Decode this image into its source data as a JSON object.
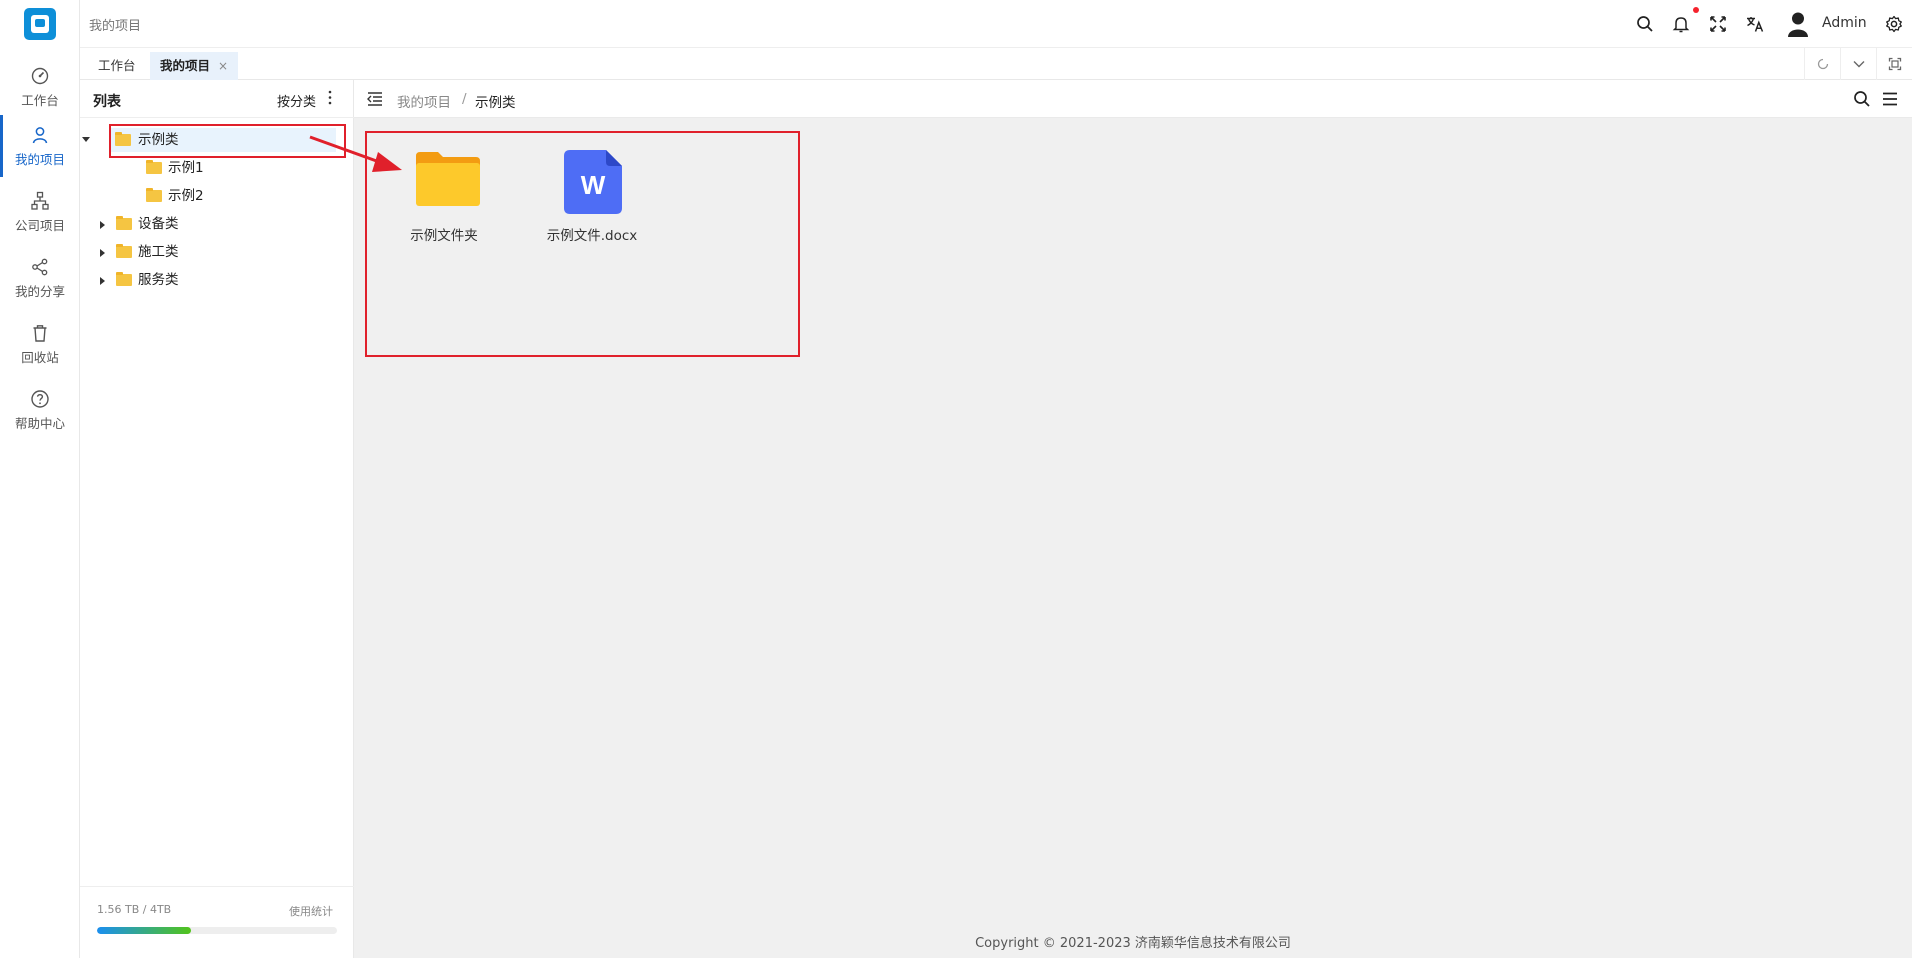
{
  "app": {
    "page_title": "我的项目",
    "brand_color": "#0e8fd8",
    "accent": "#1766c9"
  },
  "rail": {
    "items": [
      {
        "label": "工作台",
        "icon": "dashboard-icon"
      },
      {
        "label": "我的项目",
        "icon": "user-icon",
        "active": true
      },
      {
        "label": "公司项目",
        "icon": "org-chart-icon"
      },
      {
        "label": "我的分享",
        "icon": "share-icon"
      },
      {
        "label": "回收站",
        "icon": "trash-icon"
      },
      {
        "label": "帮助中心",
        "icon": "help-icon"
      }
    ]
  },
  "header": {
    "user": "Admin",
    "icons": [
      "search-icon",
      "bell-icon",
      "fullscreen-icon",
      "translate-icon",
      "avatar-icon",
      "gear-icon"
    ],
    "notification_dot": true
  },
  "tabs": [
    {
      "label": "工作台"
    },
    {
      "label": "我的项目",
      "active": true,
      "close": "×"
    }
  ],
  "tree": {
    "title": "列表",
    "sort_label": "按分类",
    "nodes": [
      {
        "label": "示例类",
        "expanded": true,
        "selected": true
      },
      {
        "label": "示例1"
      },
      {
        "label": "示例2"
      },
      {
        "label": "设备类"
      },
      {
        "label": "施工类"
      },
      {
        "label": "服务类"
      }
    ],
    "storage": {
      "used": "1.56 TB / 4TB",
      "link": "使用统计",
      "fraction": 0.39
    }
  },
  "breadcrumb": {
    "root": "我的项目",
    "sep": "/",
    "current": "示例类"
  },
  "files": [
    {
      "name": "示例文件夹",
      "type": "folder"
    },
    {
      "name": "示例文件.docx",
      "type": "docx",
      "icon_letter": "W"
    }
  ],
  "footer": {
    "copyright": "Copyright © 2021-2023 济南颖华信息技术有限公司"
  }
}
